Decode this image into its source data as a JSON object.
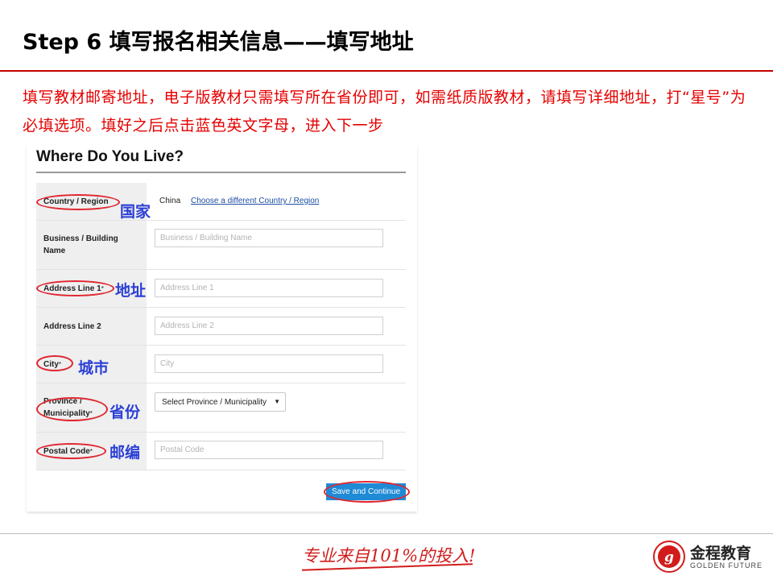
{
  "slide": {
    "title": "Step 6 填写报名相关信息——填写地址",
    "instruction": "填写教材邮寄地址，电子版教材只需填写所在省份即可，如需纸质版教材，请填写详细地址，打“星号”为必填选项。填好之后点击蓝色英文字母，进入下一步"
  },
  "form": {
    "heading": "Where Do You Live?",
    "country": {
      "label": "Country / Region",
      "value": "China",
      "change_link": "Choose a different Country / Region"
    },
    "business": {
      "label": "Business / Building Name",
      "placeholder": "Business / Building Name"
    },
    "address1": {
      "label": "Address Line 1",
      "required_mark": "*",
      "placeholder": "Address Line 1"
    },
    "address2": {
      "label": "Address Line 2",
      "placeholder": "Address Line 2"
    },
    "city": {
      "label": "City",
      "required_mark": "*",
      "placeholder": "City"
    },
    "province": {
      "label_line1": "Province /",
      "label_line2": "Municipality",
      "required_mark": "*",
      "selected": "Select Province / Municipality"
    },
    "postal": {
      "label": "Postal Code",
      "required_mark": "*",
      "placeholder": "Postal Code"
    },
    "submit_label": "Save and Continue"
  },
  "annotations": {
    "country": "国家",
    "address": "地址",
    "city": "城市",
    "province": "省份",
    "postal": "邮编"
  },
  "footer": {
    "slogan": "专业来自101%的投入!",
    "brand_cn": "金程教育",
    "brand_en": "GOLDEN FUTURE"
  },
  "colors": {
    "title_rule": "#c00000",
    "instruction_text": "#e60000",
    "annotation_oval": "#e0262f",
    "annotation_text": "#2b3fd6",
    "button": "#1f8ad6"
  },
  "icons": [
    "dropdown-arrow-icon",
    "golden-future-logo-icon"
  ]
}
